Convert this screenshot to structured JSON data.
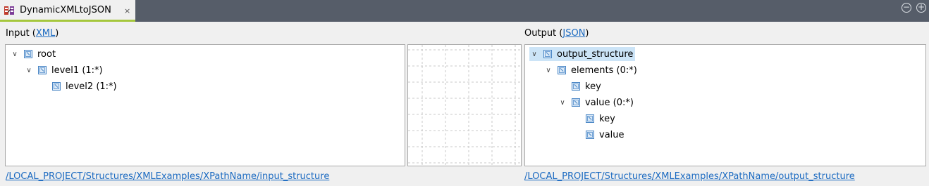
{
  "tab": {
    "title": "DynamicXMLtoJSON",
    "close": "×"
  },
  "window": {
    "minimize": "−",
    "maximize": "+"
  },
  "input": {
    "label_prefix": "Input (",
    "format": "XML",
    "label_suffix": ")",
    "tree": [
      {
        "label": "root",
        "expanded": true,
        "depth": 0
      },
      {
        "label": "level1 (1:*)",
        "expanded": true,
        "depth": 1
      },
      {
        "label": "level2 (1:*)",
        "expanded": false,
        "depth": 2
      }
    ],
    "path": "/LOCAL_PROJECT/Structures/XMLExamples/XPathName/input_structure"
  },
  "output": {
    "label_prefix": "Output (",
    "format": "JSON",
    "label_suffix": ")",
    "tree": [
      {
        "label": "output_structure",
        "expanded": true,
        "depth": 0,
        "selected": true
      },
      {
        "label": "elements (0:*)",
        "expanded": true,
        "depth": 1
      },
      {
        "label": "key",
        "expanded": false,
        "depth": 2
      },
      {
        "label": "value (0:*)",
        "expanded": true,
        "depth": 2
      },
      {
        "label": "key",
        "expanded": false,
        "depth": 3
      },
      {
        "label": "value",
        "expanded": false,
        "depth": 3
      }
    ],
    "path": "/LOCAL_PROJECT/Structures/XMLExamples/XPathName/output_structure"
  },
  "colors": {
    "tab_accent": "#a5c73c",
    "tabbar_bg": "#565d69",
    "link": "#1b6ac1",
    "selection": "#cce4f7"
  }
}
